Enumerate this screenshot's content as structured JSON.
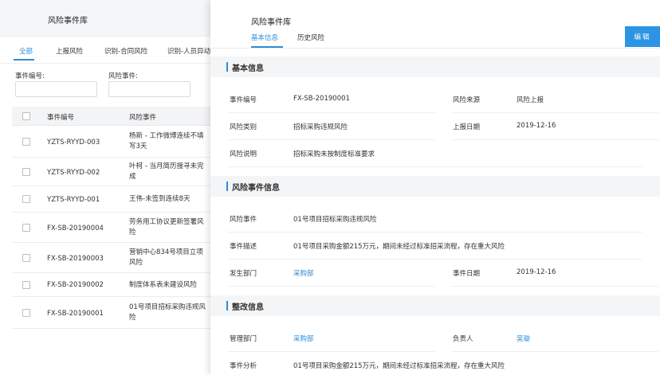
{
  "list": {
    "title": "风险事件库",
    "tabs": [
      "全部",
      "上报风险",
      "识别-合同风险",
      "识别-人员异动"
    ],
    "filters": {
      "code_label": "事件编号:",
      "event_label": "风险事件:"
    },
    "columns": {
      "code": "事件编号",
      "event": "风险事件"
    },
    "rows": [
      {
        "code": "YZTS-RYYD-003",
        "event": "杨新 - 工作微博连续不填写3天"
      },
      {
        "code": "YZTS-RYYD-002",
        "event": "叶柯 - 当月简历搜寻未完成"
      },
      {
        "code": "YZTS-RYYD-001",
        "event": "王伟-未签到连续8天"
      },
      {
        "code": "FX-SB-20190004",
        "event": "劳务用工协议更新签署风险"
      },
      {
        "code": "FX-SB-20190003",
        "event": "营销中心834号项目立项风险"
      },
      {
        "code": "FX-SB-20190002",
        "event": "制度体系表未建设风险"
      },
      {
        "code": "FX-SB-20190001",
        "event": "01号项目招标采购违规风险"
      }
    ]
  },
  "drawer": {
    "title": "风险事件库",
    "tabs": [
      "基本信息",
      "历史风险"
    ],
    "edit_label": "编辑",
    "sections": {
      "basic": {
        "title": "基本信息",
        "code_label": "事件编号",
        "code_value": "FX-SB-20190001",
        "source_label": "风险来源",
        "source_value": "风险上报",
        "type_label": "风险类别",
        "type_value": "招标采购违规风险",
        "date_label": "上报日期",
        "date_value": "2019-12-16",
        "desc_label": "风险说明",
        "desc_value": "招标采购未按制度标准要求"
      },
      "event": {
        "title": "风险事件信息",
        "event_label": "风险事件",
        "event_value": "01号项目招标采购违规风险",
        "detail_label": "事件描述",
        "detail_value": "01号项目采购金额215万元，期间未经过标准招采流程，存在重大风险",
        "dept_label": "发生部门",
        "dept_value": "采购部",
        "edate_label": "事件日期",
        "edate_value": "2019-12-16"
      },
      "fix": {
        "title": "整改信息",
        "mdept_label": "管理部门",
        "mdept_value": "采购部",
        "owner_label": "负责人",
        "owner_value": "吴璇",
        "analysis_label": "事件分析",
        "analysis_value": "01号项目采购金额215万元，期间未经过标准招采流程，存在重大风险"
      }
    }
  },
  "colors": {
    "accent": "#2f8bd6",
    "button": "#2c94e3",
    "section_bg": "#f4f5f7"
  }
}
